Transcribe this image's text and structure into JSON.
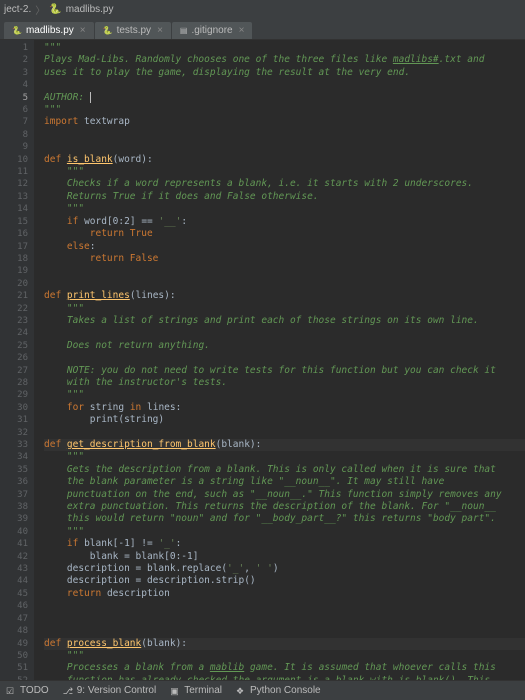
{
  "breadcrumb": {
    "project": "ject-2.",
    "file": "madlibs.py"
  },
  "tabs": [
    {
      "label": "madlibs.py",
      "active": true
    },
    {
      "label": "tests.py",
      "active": false
    },
    {
      "label": ".gitignore",
      "active": false
    }
  ],
  "cursor_line": 5,
  "code_lines": [
    {
      "n": 1,
      "segs": [
        {
          "t": "\"\"\"",
          "c": "s-doc"
        }
      ]
    },
    {
      "n": 2,
      "segs": [
        {
          "t": "Plays Mad-Libs. Randomly chooses one of the three files like ",
          "c": "s-doc"
        },
        {
          "t": "madlibs#",
          "c": "s-link"
        },
        {
          "t": ".txt and",
          "c": "s-doc"
        }
      ]
    },
    {
      "n": 3,
      "segs": [
        {
          "t": "uses it to play the game, displaying the result at the very end.",
          "c": "s-doc"
        }
      ]
    },
    {
      "n": 4,
      "segs": []
    },
    {
      "n": 5,
      "cur": true,
      "segs": [
        {
          "t": "AUTHOR: ",
          "c": "s-doc"
        },
        {
          "t": "",
          "c": "caret-holder"
        }
      ]
    },
    {
      "n": 6,
      "segs": [
        {
          "t": "\"\"\"",
          "c": "s-doc"
        }
      ]
    },
    {
      "n": 7,
      "segs": [
        {
          "t": "import",
          "c": "s-kw"
        },
        {
          "t": " textwrap",
          "c": ""
        }
      ]
    },
    {
      "n": 8,
      "segs": []
    },
    {
      "n": 9,
      "segs": []
    },
    {
      "n": 10,
      "segs": [
        {
          "t": "def ",
          "c": "s-kw"
        },
        {
          "t": "is_blank",
          "c": "s-fn s-fndecl"
        },
        {
          "t": "(word):",
          "c": ""
        }
      ]
    },
    {
      "n": 11,
      "ind": 1,
      "segs": [
        {
          "t": "\"\"\"",
          "c": "s-doc"
        }
      ]
    },
    {
      "n": 12,
      "ind": 1,
      "segs": [
        {
          "t": "Checks if a word represents a blank, i.e. it starts with 2 underscores.",
          "c": "s-doc"
        }
      ]
    },
    {
      "n": 13,
      "ind": 1,
      "segs": [
        {
          "t": "Returns True if it does and False otherwise.",
          "c": "s-doc"
        }
      ]
    },
    {
      "n": 14,
      "ind": 1,
      "segs": [
        {
          "t": "\"\"\"",
          "c": "s-doc"
        }
      ]
    },
    {
      "n": 15,
      "ind": 1,
      "segs": [
        {
          "t": "if ",
          "c": "s-kw"
        },
        {
          "t": "word[",
          "c": ""
        },
        {
          "t": "0",
          "c": ""
        },
        {
          "t": ":",
          "c": ""
        },
        {
          "t": "2",
          "c": ""
        },
        {
          "t": "] == ",
          "c": ""
        },
        {
          "t": "'__'",
          "c": "s-str"
        },
        {
          "t": ":",
          "c": ""
        }
      ]
    },
    {
      "n": 16,
      "ind": 2,
      "segs": [
        {
          "t": "return True",
          "c": "s-kw"
        }
      ]
    },
    {
      "n": 17,
      "ind": 1,
      "segs": [
        {
          "t": "else",
          "c": "s-kw"
        },
        {
          "t": ":",
          "c": ""
        }
      ]
    },
    {
      "n": 18,
      "ind": 2,
      "segs": [
        {
          "t": "return False",
          "c": "s-kw"
        }
      ]
    },
    {
      "n": 19,
      "segs": []
    },
    {
      "n": 20,
      "segs": []
    },
    {
      "n": 21,
      "segs": [
        {
          "t": "def ",
          "c": "s-kw"
        },
        {
          "t": "print_lines",
          "c": "s-fn s-fndecl"
        },
        {
          "t": "(lines):",
          "c": ""
        }
      ]
    },
    {
      "n": 22,
      "ind": 1,
      "segs": [
        {
          "t": "\"\"\"",
          "c": "s-doc"
        }
      ]
    },
    {
      "n": 23,
      "ind": 1,
      "segs": [
        {
          "t": "Takes a list of strings and print each of those strings on its own line.",
          "c": "s-doc"
        }
      ]
    },
    {
      "n": 24,
      "segs": []
    },
    {
      "n": 25,
      "ind": 1,
      "segs": [
        {
          "t": "Does not return anything.",
          "c": "s-doc"
        }
      ]
    },
    {
      "n": 26,
      "segs": []
    },
    {
      "n": 27,
      "ind": 1,
      "segs": [
        {
          "t": "NOTE: you do not need to write tests for this function but you can check it",
          "c": "s-doc"
        }
      ]
    },
    {
      "n": 28,
      "ind": 1,
      "segs": [
        {
          "t": "with the instructor's tests.",
          "c": "s-doc"
        }
      ]
    },
    {
      "n": 29,
      "ind": 1,
      "segs": [
        {
          "t": "\"\"\"",
          "c": "s-doc"
        }
      ]
    },
    {
      "n": 30,
      "ind": 1,
      "segs": [
        {
          "t": "for ",
          "c": "s-kw"
        },
        {
          "t": "string ",
          "c": ""
        },
        {
          "t": "in ",
          "c": "s-kw"
        },
        {
          "t": "lines:",
          "c": ""
        }
      ]
    },
    {
      "n": 31,
      "ind": 2,
      "segs": [
        {
          "t": "print(string)",
          "c": ""
        }
      ]
    },
    {
      "n": 32,
      "segs": []
    },
    {
      "n": 33,
      "hl": true,
      "segs": [
        {
          "t": "def ",
          "c": "s-kw"
        },
        {
          "t": "get_description_from_blank",
          "c": "s-fn s-fndecl"
        },
        {
          "t": "(blank):",
          "c": ""
        }
      ]
    },
    {
      "n": 34,
      "ind": 1,
      "segs": [
        {
          "t": "\"\"\"",
          "c": "s-doc"
        }
      ]
    },
    {
      "n": 35,
      "ind": 1,
      "segs": [
        {
          "t": "Gets the description from a blank. This is only called when it is sure that",
          "c": "s-doc"
        }
      ]
    },
    {
      "n": 36,
      "ind": 1,
      "segs": [
        {
          "t": "the blank parameter is a string like \"__noun__\". It may still have",
          "c": "s-doc"
        }
      ]
    },
    {
      "n": 37,
      "ind": 1,
      "segs": [
        {
          "t": "punctuation on the end, such as \"__noun__.\" This function simply removes any",
          "c": "s-doc"
        }
      ]
    },
    {
      "n": 38,
      "ind": 1,
      "segs": [
        {
          "t": "extra punctuation. This returns the description of the blank. For \"__noun__",
          "c": "s-doc"
        }
      ]
    },
    {
      "n": 39,
      "ind": 1,
      "segs": [
        {
          "t": "this would return \"noun\" and for \"__body_part__?\" this returns \"body part\".",
          "c": "s-doc"
        }
      ]
    },
    {
      "n": 40,
      "ind": 1,
      "segs": [
        {
          "t": "\"\"\"",
          "c": "s-doc"
        }
      ]
    },
    {
      "n": 41,
      "ind": 1,
      "segs": [
        {
          "t": "if ",
          "c": "s-kw"
        },
        {
          "t": "blank[-",
          "c": ""
        },
        {
          "t": "1",
          "c": ""
        },
        {
          "t": "] != ",
          "c": ""
        },
        {
          "t": "'_'",
          "c": "s-str"
        },
        {
          "t": ":",
          "c": ""
        }
      ]
    },
    {
      "n": 42,
      "ind": 2,
      "segs": [
        {
          "t": "blank = blank[",
          "c": ""
        },
        {
          "t": "0",
          "c": ""
        },
        {
          "t": ":-",
          "c": ""
        },
        {
          "t": "1",
          "c": ""
        },
        {
          "t": "]",
          "c": ""
        }
      ]
    },
    {
      "n": 43,
      "ind": 1,
      "segs": [
        {
          "t": "description = blank.replace(",
          "c": ""
        },
        {
          "t": "'_'",
          "c": "s-str"
        },
        {
          "t": ", ",
          "c": ""
        },
        {
          "t": "' '",
          "c": "s-str"
        },
        {
          "t": ")",
          "c": ""
        }
      ]
    },
    {
      "n": 44,
      "ind": 1,
      "segs": [
        {
          "t": "description = description.strip()",
          "c": ""
        }
      ]
    },
    {
      "n": 45,
      "ind": 1,
      "segs": [
        {
          "t": "return ",
          "c": "s-kw"
        },
        {
          "t": "description",
          "c": ""
        }
      ]
    },
    {
      "n": 46,
      "segs": []
    },
    {
      "n": 47,
      "segs": []
    },
    {
      "n": 48,
      "segs": []
    },
    {
      "n": 49,
      "hl": true,
      "segs": [
        {
          "t": "def ",
          "c": "s-kw"
        },
        {
          "t": "process_blank",
          "c": "s-fn s-fndecl"
        },
        {
          "t": "(blank):",
          "c": ""
        }
      ]
    },
    {
      "n": 50,
      "ind": 1,
      "segs": [
        {
          "t": "\"\"\"",
          "c": "s-doc"
        }
      ]
    },
    {
      "n": 51,
      "ind": 1,
      "segs": [
        {
          "t": "Processes a blank from a ",
          "c": "s-doc"
        },
        {
          "t": "mablib",
          "c": "s-link"
        },
        {
          "t": " game. It is assumed that whoever calls this",
          "c": "s-doc"
        }
      ]
    },
    {
      "n": 52,
      "ind": 1,
      "segs": [
        {
          "t": "function has already checked the argument is a blank with is_blank(). This",
          "c": "s-doc"
        }
      ]
    }
  ],
  "statusbar": {
    "todo": "TODO",
    "vcs": "9: Version Control",
    "terminal": "Terminal",
    "pyconsole": "Python Console"
  }
}
